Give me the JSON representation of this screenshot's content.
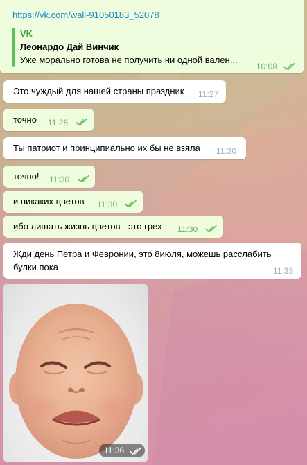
{
  "messages": [
    {
      "type": "link_preview",
      "direction": "out",
      "link": "https://vk.com/wall-91050183_52078",
      "preview": {
        "site": "VK",
        "title": "Леонардо Дай Винчик",
        "description": "Уже морально готова не получить ни одной вален..."
      },
      "time": "10:08"
    },
    {
      "direction": "in",
      "text": "Это чуждый для нашей страны праздник",
      "time": "11:27"
    },
    {
      "direction": "out",
      "text": "точно",
      "time": "11:28"
    },
    {
      "direction": "in",
      "text": "Ты патриот и принципиально их бы не взяла",
      "time": "11:30"
    },
    {
      "direction": "out",
      "text": "точно!",
      "time": "11:30"
    },
    {
      "direction": "out",
      "text": "и никаких цветов",
      "time": "11:30"
    },
    {
      "direction": "out",
      "text": "ибо лишать жизнь цветов - это грех",
      "time": "11:30"
    },
    {
      "direction": "in",
      "text_line1": "Жди день Петра и Февронии, это 8июля, можешь расслабить",
      "text_line2": "булки пока",
      "time": "11:33"
    },
    {
      "type": "photo",
      "direction": "out",
      "time": "11:36"
    }
  ],
  "colors": {
    "outgoing_bubble": "#effdde",
    "incoming_bubble": "#ffffff",
    "link": "#168acd",
    "read_check": "#5fbf5c",
    "incoming_time": "#a0acb6"
  },
  "icons": [
    "double-check-icon"
  ]
}
